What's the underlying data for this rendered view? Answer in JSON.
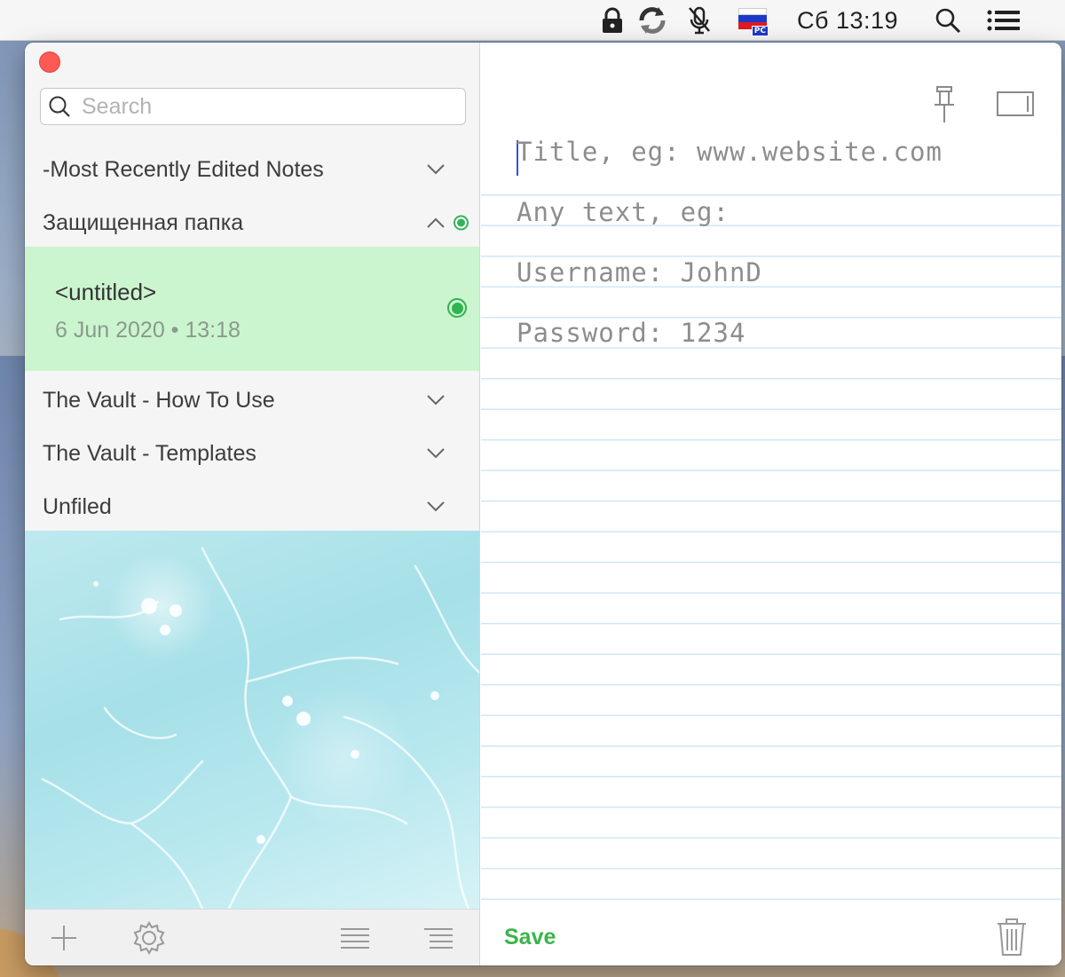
{
  "menubar": {
    "clock": "Сб 13:19",
    "flag_badge": "PC",
    "icons": [
      "lock-icon",
      "sync-icon",
      "microphone-off-icon",
      "russian-flag-icon",
      "spotlight-search-icon",
      "control-center-icon"
    ]
  },
  "sidebar": {
    "search_placeholder": "Search",
    "folders": [
      {
        "label": "-Most Recently Edited Notes",
        "expanded": false
      },
      {
        "label": "Защищенная папка",
        "expanded": true,
        "status": "protected"
      },
      {
        "label": "The Vault - How To Use",
        "expanded": false
      },
      {
        "label": "The Vault - Templates",
        "expanded": false
      },
      {
        "label": "Unfiled",
        "expanded": false
      }
    ],
    "selected_note": {
      "title": "<untitled>",
      "date": "6 Jun 2020 • 13:18"
    },
    "footer_icons": [
      "add-icon",
      "gear-icon",
      "list-icon",
      "outline-list-icon"
    ]
  },
  "editor": {
    "lines": [
      "Title, eg: www.website.com",
      "Any text, eg:",
      "Username: JohnD",
      "Password: 1234"
    ],
    "save_label": "Save",
    "icons": [
      "pin-icon",
      "fullscreen-icon",
      "trash-icon"
    ]
  },
  "colors": {
    "accent_green": "#33b35a",
    "selected_note_bg": "#cbf5cf",
    "close_red": "#fc5a52",
    "rule_line": "#cde8f4"
  }
}
